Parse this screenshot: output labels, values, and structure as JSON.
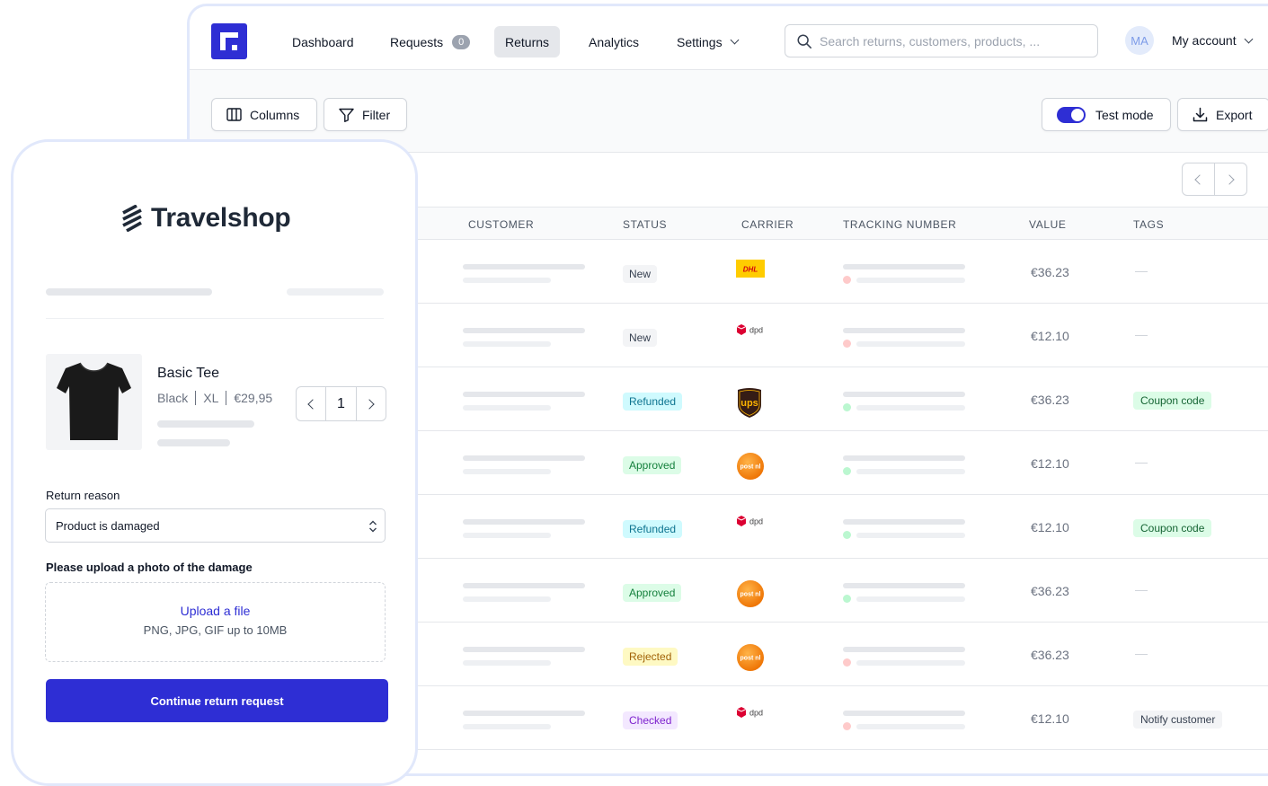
{
  "nav": {
    "items": [
      {
        "label": "Dashboard"
      },
      {
        "label": "Requests",
        "count": "0"
      },
      {
        "label": "Returns"
      },
      {
        "label": "Analytics"
      },
      {
        "label": "Settings"
      }
    ],
    "search_placeholder": "Search returns, customers, products, ...",
    "avatar_initials": "MA",
    "account_label": "My account"
  },
  "toolbar": {
    "columns_label": "Columns",
    "filter_label": "Filter",
    "test_mode_label": "Test mode",
    "test_mode_on": true,
    "export_label": "Export"
  },
  "table": {
    "headers": [
      "CUSTOMER",
      "STATUS",
      "CARRIER",
      "TRACKING NUMBER",
      "VALUE",
      "TAGS"
    ],
    "rows": [
      {
        "status": "New",
        "carrier": "dhl",
        "value": "€36.23",
        "tag": "—",
        "tracking_state": "red"
      },
      {
        "status": "New",
        "carrier": "dpd",
        "value": "€12.10",
        "tag": "—",
        "tracking_state": "red"
      },
      {
        "status": "Refunded",
        "carrier": "ups",
        "value": "€36.23",
        "tag": "Coupon code",
        "tracking_state": "green"
      },
      {
        "status": "Approved",
        "carrier": "postnl",
        "value": "€12.10",
        "tag": "—",
        "tracking_state": "green"
      },
      {
        "status": "Refunded",
        "carrier": "dpd",
        "value": "€12.10",
        "tag": "Coupon code",
        "tracking_state": "green"
      },
      {
        "status": "Approved",
        "carrier": "postnl",
        "value": "€36.23",
        "tag": "—",
        "tracking_state": "green"
      },
      {
        "status": "Rejected",
        "carrier": "postnl",
        "value": "€36.23",
        "tag": "—",
        "tracking_state": "red"
      },
      {
        "status": "Checked",
        "carrier": "dpd",
        "value": "€12.10",
        "tag": "Notify customer",
        "tracking_state": "red"
      }
    ]
  },
  "colors": {
    "accent": "#2e2ed4",
    "new_bg": "#f3f4f6",
    "refunded_bg": "#cffafe",
    "approved_bg": "#dcfce7",
    "rejected_bg": "#fef9c3",
    "checked_bg": "#f3e8ff"
  },
  "phone": {
    "brand": "Travelshop",
    "product": {
      "name": "Basic Tee",
      "color": "Black",
      "size": "XL",
      "price": "€29,95",
      "quantity": "1"
    },
    "return_reason_label": "Return reason",
    "return_reason_value": "Product is damaged",
    "upload_label": "Please upload a photo of the damage",
    "upload_link": "Upload a file",
    "upload_hint": "PNG, JPG, GIF up to 10MB",
    "cta_label": "Continue return request"
  }
}
